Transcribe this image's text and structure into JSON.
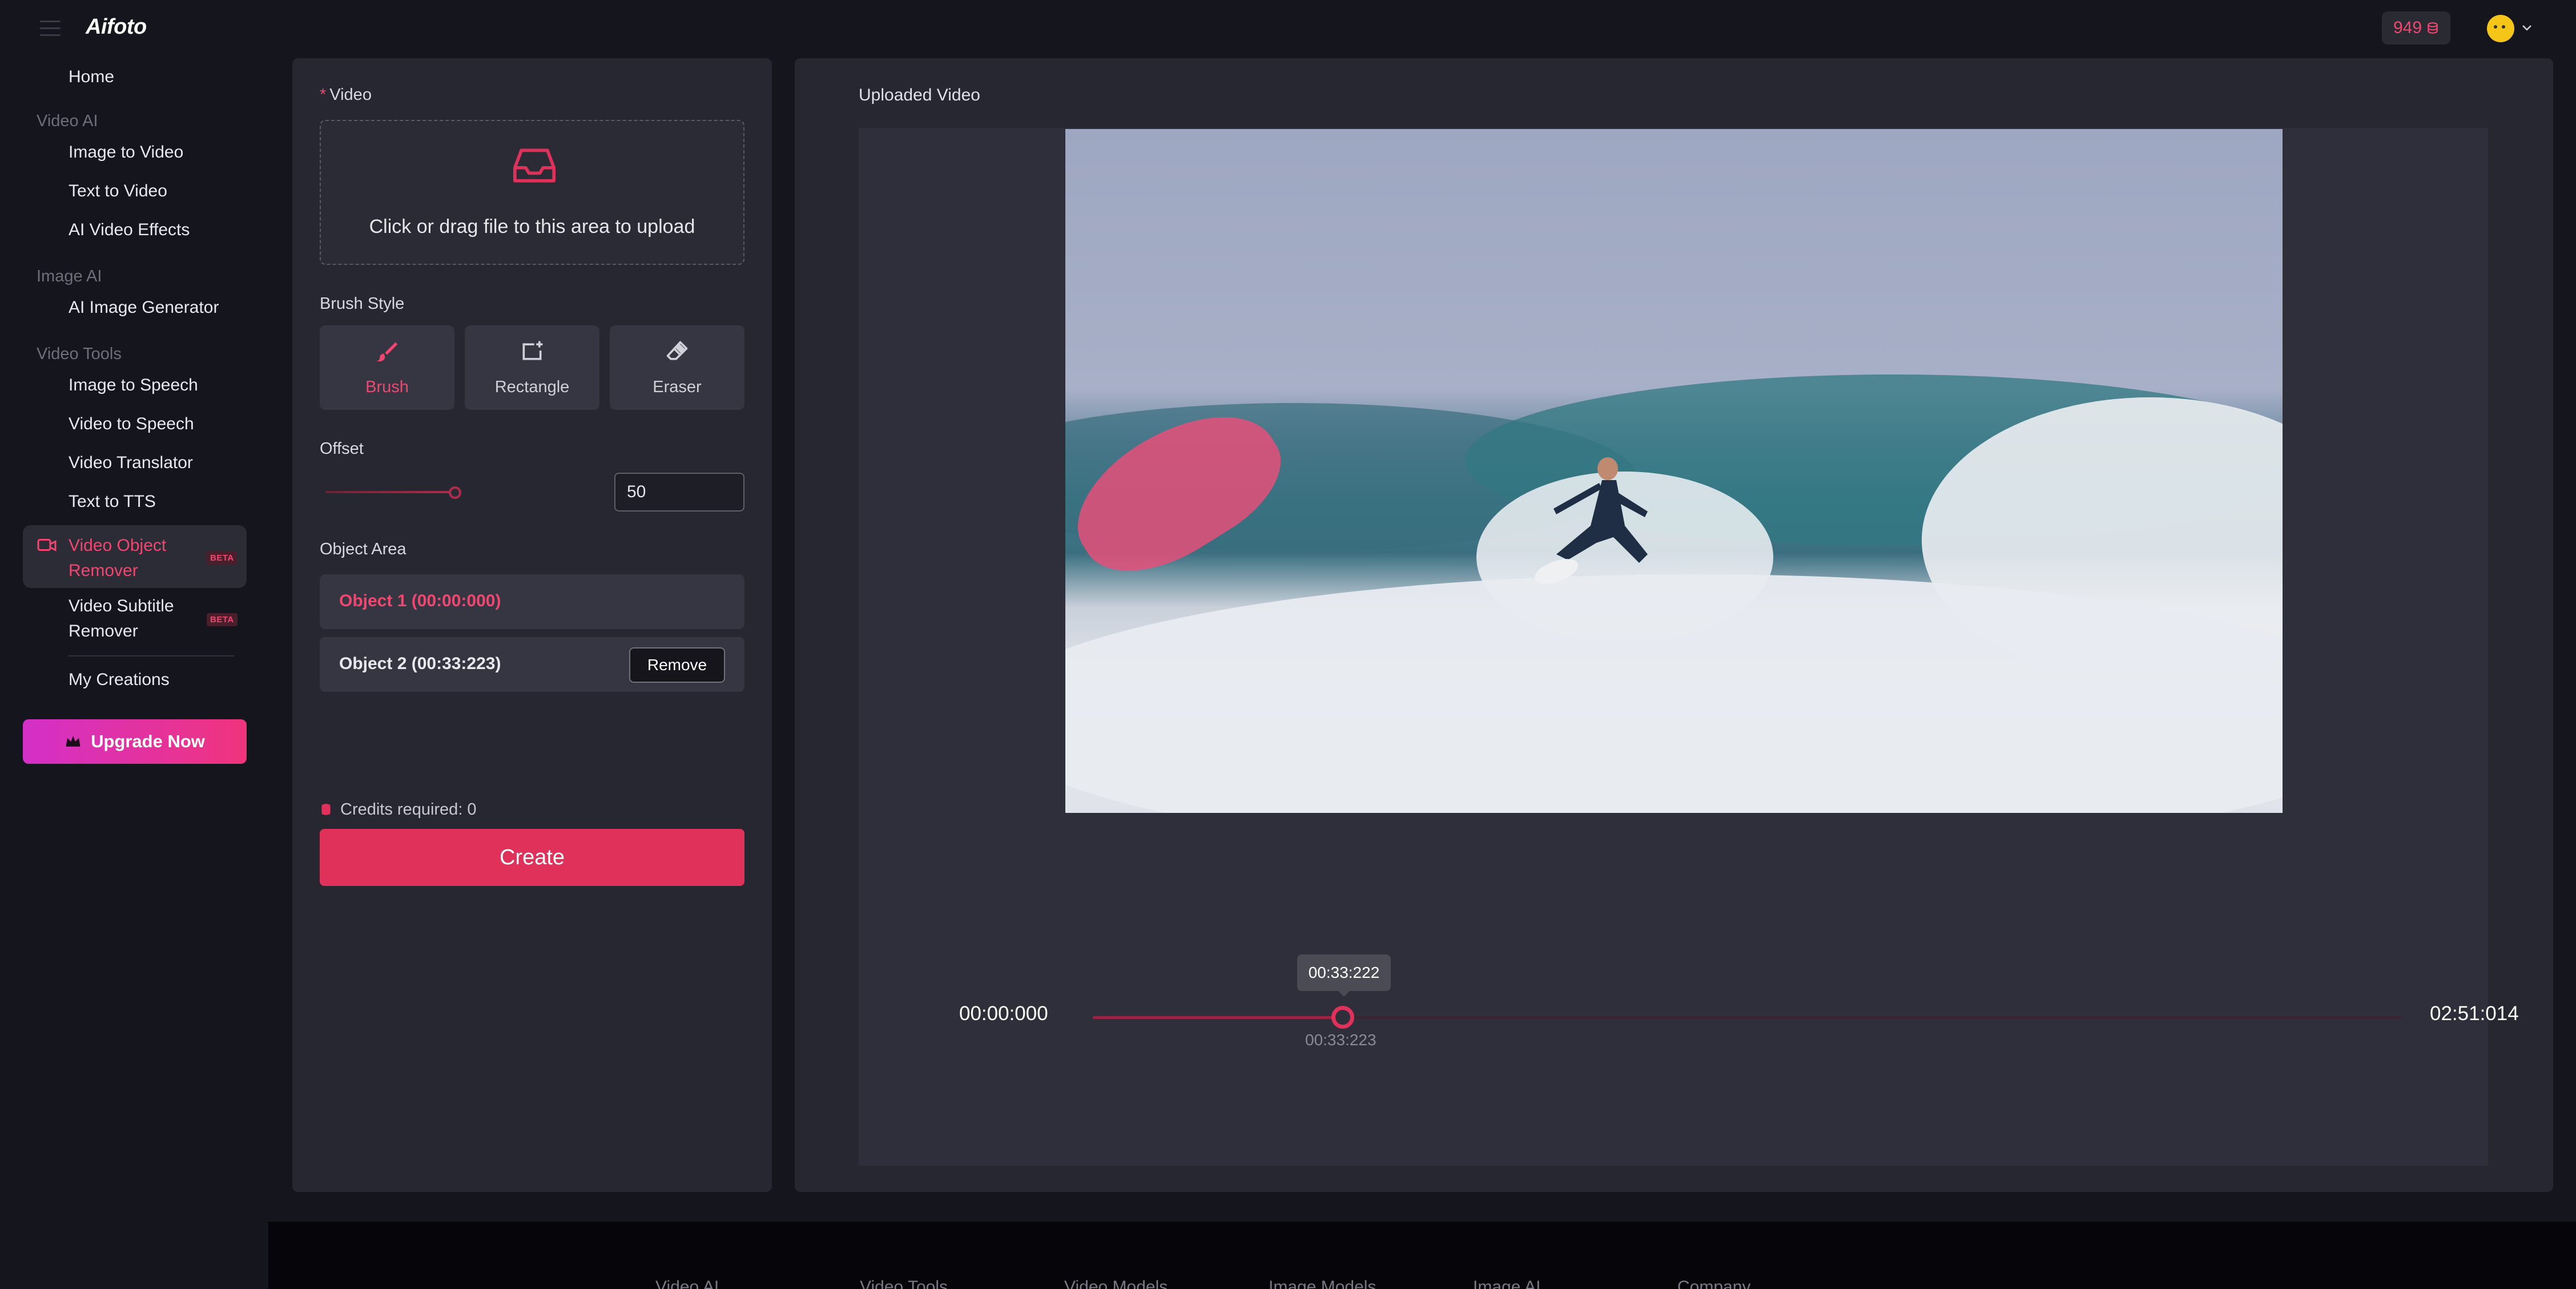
{
  "app": {
    "logo": "Aifoto",
    "credits": "949",
    "accent_color": "#e0315a"
  },
  "sidebar": {
    "home": "Home",
    "group_video_ai": "Video AI",
    "image_to_video": "Image to Video",
    "text_to_video": "Text to Video",
    "ai_video_effects": "AI Video Effects",
    "group_image_ai": "Image AI",
    "ai_image_generator": "AI Image Generator",
    "group_video_tools": "Video Tools",
    "image_to_speech": "Image to Speech",
    "video_to_speech": "Video to Speech",
    "video_translator": "Video Translator",
    "text_to_tts": "Text to TTS",
    "video_object_remover": "Video Object Remover",
    "video_subtitle_remover": "Video Subtitle Remover",
    "beta_badge": "BETA",
    "my_creations": "My Creations",
    "upgrade": "Upgrade Now"
  },
  "form": {
    "video_label": "Video",
    "required_mark": "*",
    "upload_text": "Click or drag file to this area to upload",
    "brush_style_label": "Brush Style",
    "brush_options": {
      "brush": "Brush",
      "rectangle": "Rectangle",
      "eraser": "Eraser"
    },
    "selected_brush": "Brush",
    "offset_label": "Offset",
    "offset_value": "50",
    "object_area_label": "Object Area",
    "objects": [
      {
        "label": "Object 1 (00:00:000)"
      },
      {
        "label": "Object 2 (00:33:223)",
        "action": "Remove"
      }
    ],
    "credits_required": "Credits required: 0",
    "create_button": "Create"
  },
  "preview": {
    "title": "Uploaded Video",
    "time_start": "00:00:000",
    "time_end": "02:51:014",
    "tooltip_time": "00:33:222",
    "current_time": "00:33:223"
  },
  "footer": {
    "columns": [
      "Video AI",
      "Video Tools",
      "Video Models",
      "Image Models",
      "Image AI",
      "Company"
    ]
  }
}
